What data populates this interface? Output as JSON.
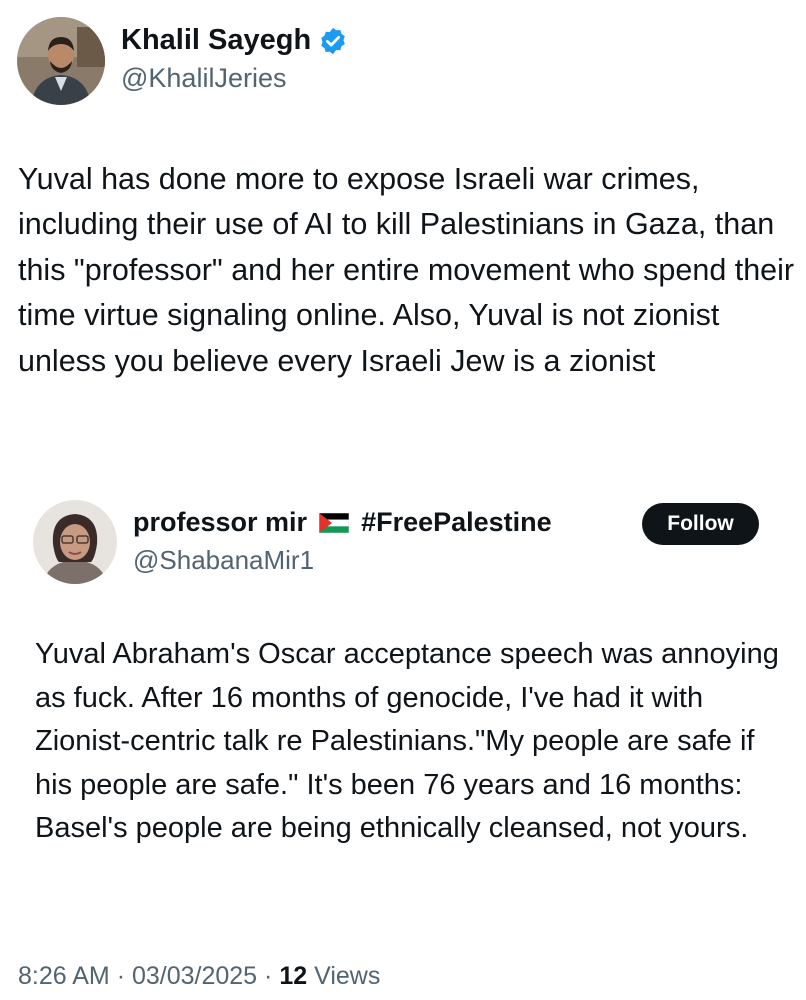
{
  "tweet": {
    "author": {
      "name": "Khalil Sayegh",
      "handle": "@KhalilJeries",
      "verified": true,
      "verified_icon": "verified-badge-icon",
      "verified_color": "#1d9bf0"
    },
    "text": "Yuval has done more to expose Israeli war crimes, including their use of AI to kill Palestinians in Gaza, than this \"professor\" and her entire movement who spend their time virtue signaling online. Also, Yuval is not zionist unless you believe every Israeli Jew is a zionist",
    "time": "8:26 AM",
    "separator": "·",
    "date": "03/03/2025",
    "views_count": "12",
    "views_label": "Views"
  },
  "quoted_tweet": {
    "author": {
      "name_part1": "professor mir",
      "flag_icon": "palestine-flag-icon",
      "name_part2": "#FreePalestine",
      "handle": "@ShabanaMir1"
    },
    "follow_label": "Follow",
    "text": "Yuval Abraham's Oscar acceptance speech was annoying as fuck. After 16 months of genocide, I've had it with Zionist-centric talk re Palestinians.\"My people are safe if his people are safe.\" It's been 76 years and 16 months: Basel's people are being ethnically cleansed, not yours."
  },
  "colors": {
    "text_primary": "#0f1419",
    "text_secondary": "#536471",
    "button_bg": "#0f1419",
    "verified_blue": "#1d9bf0"
  }
}
